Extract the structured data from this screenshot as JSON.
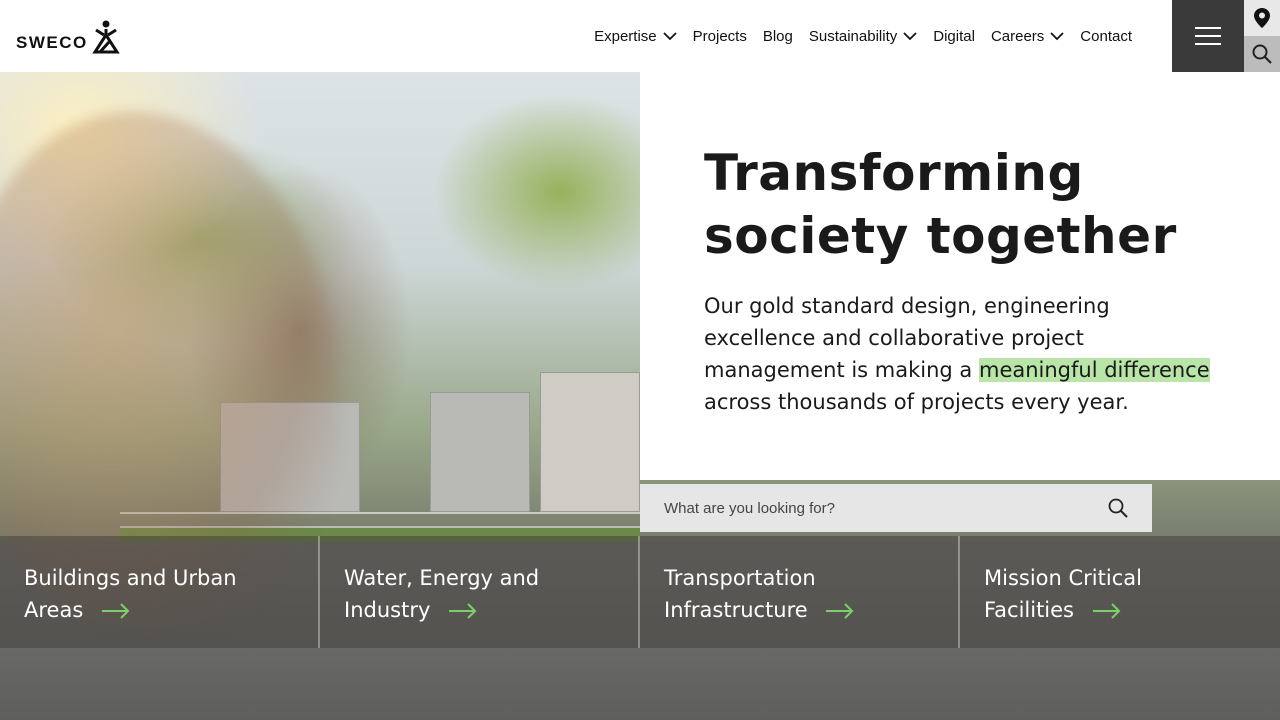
{
  "brand": {
    "name": "SWECO",
    "accent": "#b9e5a8",
    "arrow_color": "#7ccf6a"
  },
  "nav": {
    "items": [
      {
        "label": "Expertise",
        "has_dropdown": true
      },
      {
        "label": "Projects",
        "has_dropdown": false
      },
      {
        "label": "Blog",
        "has_dropdown": false
      },
      {
        "label": "Sustainability",
        "has_dropdown": true
      },
      {
        "label": "Digital",
        "has_dropdown": false
      },
      {
        "label": "Careers",
        "has_dropdown": true
      },
      {
        "label": "Contact",
        "has_dropdown": false
      }
    ],
    "menu_icon": "hamburger-icon",
    "location_icon": "location-pin-icon",
    "search_icon": "search-icon"
  },
  "hero": {
    "title_line1": "Transforming",
    "title_line2": "society together",
    "desc_before": "Our gold standard design, engineering excellence and collaborative project management is making a ",
    "desc_highlight": "meaningful difference",
    "desc_after": " across thousands of projects every year."
  },
  "search": {
    "placeholder": "What are you looking for?",
    "value": ""
  },
  "tiles": [
    {
      "line1": "Buildings and Urban",
      "line2": "Areas"
    },
    {
      "line1": "Water, Energy and",
      "line2": "Industry"
    },
    {
      "line1": "Transportation",
      "line2": "Infrastructure"
    },
    {
      "line1": "Mission Critical",
      "line2": "Facilities"
    }
  ]
}
